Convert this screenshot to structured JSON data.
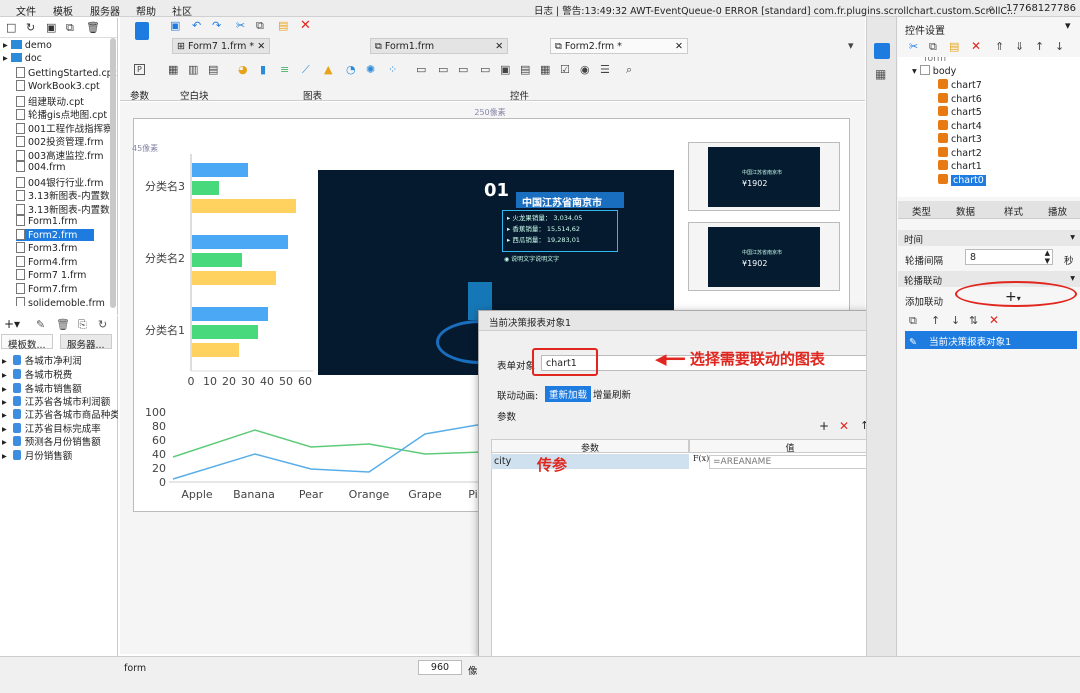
{
  "menu": [
    "文件",
    "模板",
    "服务器",
    "帮助",
    "社区"
  ],
  "status": {
    "log": "日志 | 警告:13:49:32 AWT-EventQueue-0 ERROR [standard] com.fr.plugins.scrollchart.custom.ScrollC...",
    "phone": "17768127786"
  },
  "file_tree": [
    "demo",
    "doc",
    "GettingStarted.cpt",
    "WorkBook3.cpt",
    "组建联动.cpt",
    "轮播gis点地图.cpt",
    "001工程作战指挥察",
    "002投资管理.frm",
    "003高速监控.frm",
    "004.frm",
    "004银行行业.frm",
    "3.13新图表-内置数",
    "3.13新图表-内置数",
    "Form1.frm",
    "Form2.frm",
    "Form3.frm",
    "Form4.frm",
    "Form7 1.frm",
    "Form7.frm",
    "solidemoble.frm"
  ],
  "left_tabs": [
    "模板数...",
    "服务器..."
  ],
  "datasets": [
    "各城市净利润",
    "各城市税费",
    "各城市销售额",
    "江苏省各城市利润额",
    "江苏省各城市商品种类",
    "江苏省目标完成率",
    "预测各月份销售额",
    "月份销售额"
  ],
  "doc_tabs": [
    "Form7 1.frm *",
    "Form1.frm",
    "Form2.frm *"
  ],
  "groups": {
    "params": "参数",
    "blank": "空白块",
    "chart": "图表",
    "widget": "控件"
  },
  "canvas": {
    "ruler_top": "250像素",
    "ruler_left": "45像素"
  },
  "bar_chart": {
    "categories": [
      "分类名1",
      "分类名2",
      "分类名3"
    ],
    "ticks": [
      "0",
      "10",
      "20",
      "30",
      "40",
      "50",
      "60"
    ],
    "colors": [
      "#4aa8f5",
      "#47d97b",
      "#ffd15e"
    ]
  },
  "line_chart": {
    "categories": [
      "Apple",
      "Banana",
      "Pear",
      "Orange",
      "Grape",
      "Pi"
    ],
    "yticks": [
      "100",
      "80",
      "60",
      "40",
      "20",
      "0"
    ],
    "colors": [
      "#5ecb7a",
      "#5aaee8"
    ]
  },
  "panel": {
    "num": "01",
    "city": "中国江苏省南京市",
    "lines": [
      "▸ 火龙果销量： 3,034,05",
      "▸ 香蕉销量： 15,514,62",
      "▸ 西瓜销量： 19,283,01"
    ],
    "caption": "说明文字说明文字"
  },
  "thumb": {
    "title": "中国江苏省南京市",
    "value": "¥1902"
  },
  "dialog": {
    "title": "当前决策报表对象1",
    "form_label": "表单对象",
    "form_value": "chart1",
    "anim_label": "联动动画:",
    "anim_opt1": "重新加载",
    "anim_opt2": "增量刷新",
    "params_label": "参数",
    "col_param": "参数",
    "col_value": "值",
    "row_param": "city",
    "row_value": "=AREANAME"
  },
  "annotations": {
    "choose": "选择需要联动的图表",
    "pass": "传参"
  },
  "right": {
    "title": "控件设置",
    "tree": [
      "form",
      "body",
      "chart7",
      "chart6",
      "chart5",
      "chart4",
      "chart3",
      "chart2",
      "chart1",
      "chart0"
    ],
    "tabs": [
      "类型",
      "数据",
      "样式",
      "播放"
    ],
    "sec_time": "时间",
    "interval_label": "轮播间隔",
    "interval_value": "8",
    "unit": "秒",
    "sec_link": "轮播联动",
    "add_link": "添加联动",
    "link_item": "当前决策报表对象1"
  },
  "bottom": {
    "name": "form",
    "width": "960",
    "unit": "像"
  }
}
